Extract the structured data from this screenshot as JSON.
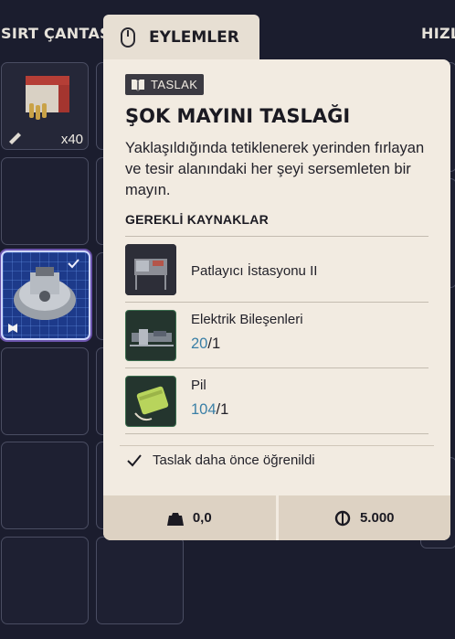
{
  "header": {
    "backpack_label": "SIRT ÇANTASI",
    "quick_label": "HIZL"
  },
  "inventory": {
    "slot1_qty": "x40"
  },
  "tooltip": {
    "tab_label": "EYLEMLER",
    "badge": "TASLAK",
    "title": "ŞOK MAYINI TASLAĞI",
    "description": "Yaklaşıldığında tetiklenerek yerinden fırlayan ve tesir alanındaki her şeyi sersemleten bir mayın.",
    "requirements_header": "GEREKLİ KAYNAKLAR",
    "requirements": [
      {
        "name": "Patlayıcı İstasyonu II",
        "have": "",
        "need": ""
      },
      {
        "name": "Elektrik Bileşenleri",
        "have": "20",
        "need": "/1"
      },
      {
        "name": "Pil",
        "have": "104",
        "need": "/1"
      }
    ],
    "learned_text": "Taslak daha önce öğrenildi",
    "weight": "0,0",
    "price": "5.000"
  },
  "colors": {
    "background": "#1b1d2e",
    "card": "#f2ebe1",
    "footer": "#ddd2c3",
    "have_count": "#3a7fa6"
  }
}
